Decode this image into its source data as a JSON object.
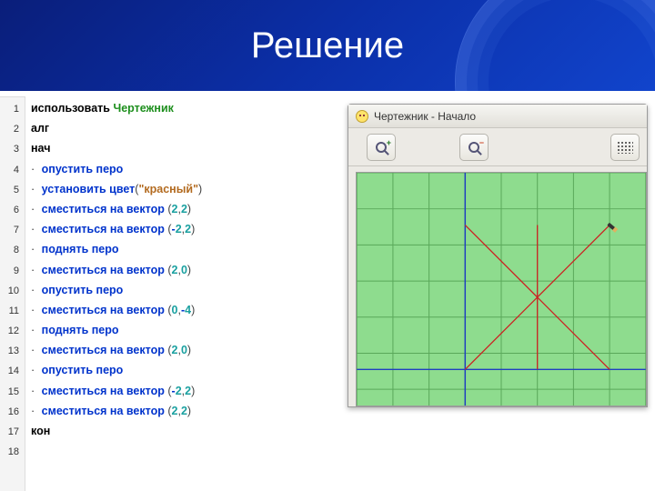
{
  "slide": {
    "title": "Решение"
  },
  "code": {
    "lines": [
      {
        "n": 1,
        "t": "kw_perf",
        "kw": "использовать",
        "perf": "Чертежник"
      },
      {
        "n": 2,
        "t": "kw",
        "kw": "алг"
      },
      {
        "n": 3,
        "t": "kw",
        "kw": "нач"
      },
      {
        "n": 4,
        "t": "cmd",
        "cmd": "опустить перо"
      },
      {
        "n": 5,
        "t": "call_str",
        "cmd": "установить цвет",
        "str": "\"красный\""
      },
      {
        "n": 6,
        "t": "call_vec",
        "cmd": "сместиться на вектор",
        "a": "2",
        "b": "2"
      },
      {
        "n": 7,
        "t": "call_vec",
        "cmd": "сместиться на вектор",
        "a": "-2",
        "b": "2"
      },
      {
        "n": 8,
        "t": "cmd",
        "cmd": "поднять перо"
      },
      {
        "n": 9,
        "t": "call_vec",
        "cmd": "сместиться на вектор",
        "a": "2",
        "b": "0"
      },
      {
        "n": 10,
        "t": "cmd",
        "cmd": "опустить перо"
      },
      {
        "n": 11,
        "t": "call_vec",
        "cmd": "сместиться на вектор",
        "a": "0",
        "b": "-4"
      },
      {
        "n": 12,
        "t": "cmd",
        "cmd": "поднять перо"
      },
      {
        "n": 13,
        "t": "call_vec",
        "cmd": "сместиться на вектор",
        "a": "2",
        "b": "0"
      },
      {
        "n": 14,
        "t": "cmd",
        "cmd": "опустить перо"
      },
      {
        "n": 15,
        "t": "call_vec",
        "cmd": "сместиться на вектор",
        "a": "-2",
        "b": "2"
      },
      {
        "n": 16,
        "t": "call_vec",
        "cmd": "сместиться на вектор",
        "a": "2",
        "b": "2"
      },
      {
        "n": 17,
        "t": "kw",
        "kw": "кон"
      },
      {
        "n": 18,
        "t": "empty"
      }
    ]
  },
  "preview": {
    "title": "Чертежник - Начало",
    "zoom_in": "+",
    "zoom_out": "−"
  },
  "chart_data": {
    "type": "line",
    "title": "",
    "xlim": [
      -3,
      5
    ],
    "ylim": [
      -1,
      5
    ],
    "grid": true,
    "axes": true,
    "series": [
      {
        "name": "seg1",
        "x": [
          0,
          2,
          0
        ],
        "y": [
          0,
          2,
          4
        ],
        "color": "#cc2222"
      },
      {
        "name": "seg2",
        "x": [
          2,
          2
        ],
        "y": [
          4,
          0
        ],
        "color": "#cc2222"
      },
      {
        "name": "seg3",
        "x": [
          4,
          2,
          4
        ],
        "y": [
          0,
          2,
          4
        ],
        "color": "#cc2222"
      }
    ],
    "cursor": {
      "x": 4,
      "y": 4
    }
  }
}
